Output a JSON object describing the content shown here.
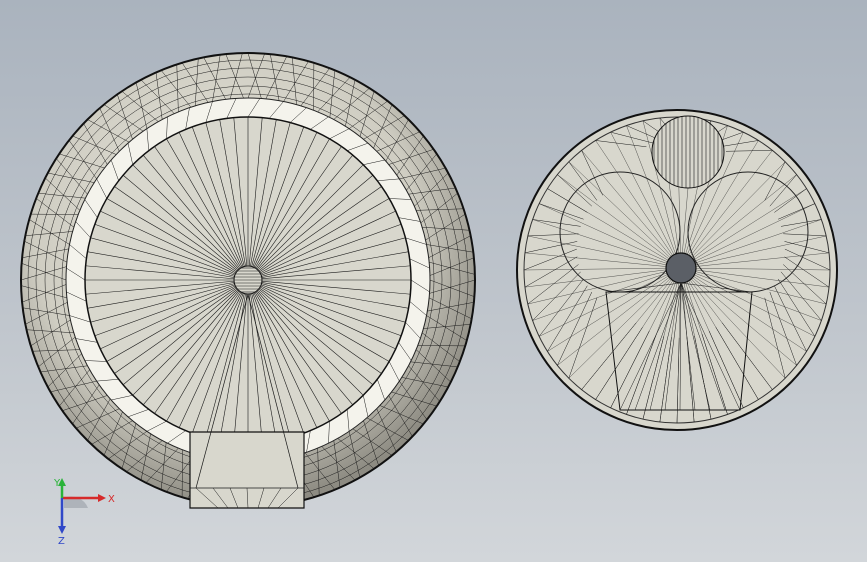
{
  "viewport": {
    "background_top": "#aab3be",
    "background_bottom": "#d2d6da",
    "face_color": "#d8d7cd",
    "edge_color": "#1a1a1a"
  },
  "triad": {
    "x_label": "X",
    "y_label": "Y",
    "z_label": "Z",
    "x_color": "#d62a2a",
    "y_color": "#2ab33a",
    "z_color": "#3048c8"
  }
}
